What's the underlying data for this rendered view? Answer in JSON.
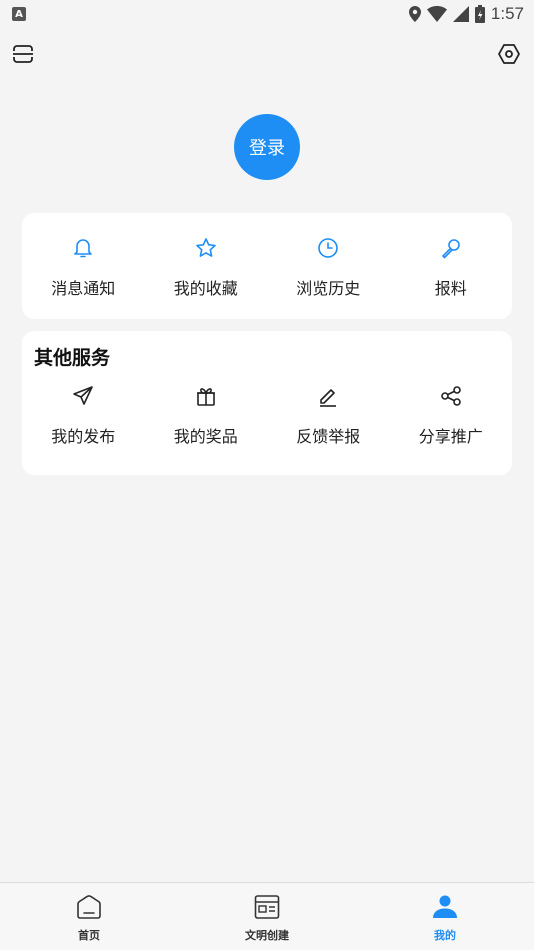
{
  "status_bar": {
    "time": "1:57",
    "notification_glyph": "A"
  },
  "header": {
    "left_icon": "scan-icon",
    "right_icon": "settings-icon"
  },
  "login": {
    "label": "登录"
  },
  "quick_actions": [
    {
      "label": "消息通知",
      "icon": "bell-icon"
    },
    {
      "label": "我的收藏",
      "icon": "star-icon"
    },
    {
      "label": "浏览历史",
      "icon": "clock-icon"
    },
    {
      "label": "报料",
      "icon": "microphone-icon"
    }
  ],
  "services": {
    "title": "其他服务",
    "items": [
      {
        "label": "我的发布",
        "icon": "send-icon"
      },
      {
        "label": "我的奖品",
        "icon": "gift-icon"
      },
      {
        "label": "反馈举报",
        "icon": "edit-icon"
      },
      {
        "label": "分享推广",
        "icon": "share-icon"
      }
    ]
  },
  "bottom_nav": {
    "items": [
      {
        "label": "首页",
        "icon": "home-icon",
        "active": false
      },
      {
        "label": "文明创建",
        "icon": "news-icon",
        "active": false
      },
      {
        "label": "我的",
        "icon": "user-icon",
        "active": true
      }
    ]
  },
  "colors": {
    "accent": "#1e8ef5",
    "background": "#f4f4f4",
    "card": "#ffffff"
  }
}
